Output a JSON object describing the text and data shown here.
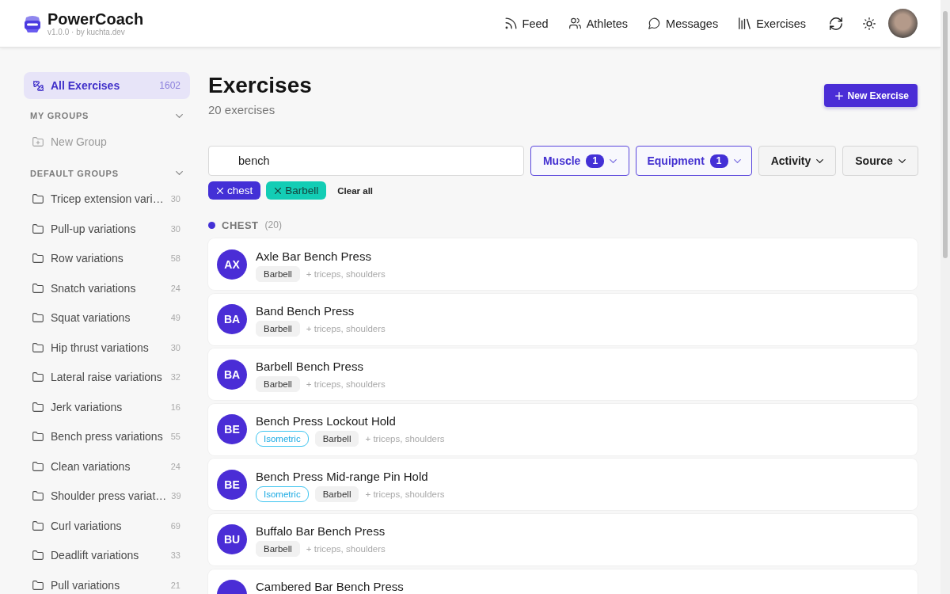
{
  "header": {
    "app_name": "PowerCoach",
    "version": "v1.0.0 · by kuchta.dev",
    "nav": [
      {
        "label": "Feed"
      },
      {
        "label": "Athletes"
      },
      {
        "label": "Messages"
      },
      {
        "label": "Exercises"
      }
    ]
  },
  "sidebar": {
    "all_item": {
      "label": "All Exercises",
      "count": "1602",
      "selected": true
    },
    "sections": [
      {
        "title": "MY GROUPS",
        "expanded": true,
        "items": [
          {
            "kind": "add",
            "label": "New Group"
          }
        ]
      },
      {
        "title": "DEFAULT GROUPS",
        "expanded": true,
        "items": [
          {
            "kind": "group",
            "label": "Tricep extension vari…",
            "count": "30"
          },
          {
            "kind": "group",
            "label": "Pull-up variations",
            "count": "30"
          },
          {
            "kind": "group",
            "label": "Row variations",
            "count": "58"
          },
          {
            "kind": "group",
            "label": "Snatch variations",
            "count": "24"
          },
          {
            "kind": "group",
            "label": "Squat variations",
            "count": "49"
          },
          {
            "kind": "group",
            "label": "Hip thrust variations",
            "count": "30"
          },
          {
            "kind": "group",
            "label": "Lateral raise variations",
            "count": "32"
          },
          {
            "kind": "group",
            "label": "Jerk variations",
            "count": "16"
          },
          {
            "kind": "group",
            "label": "Bench press variations",
            "count": "55"
          },
          {
            "kind": "group",
            "label": "Clean variations",
            "count": "24"
          },
          {
            "kind": "group",
            "label": "Shoulder press variat…",
            "count": "39"
          },
          {
            "kind": "group",
            "label": "Curl variations",
            "count": "69"
          },
          {
            "kind": "group",
            "label": "Deadlift variations",
            "count": "33"
          },
          {
            "kind": "group",
            "label": "Pull variations",
            "count": "21"
          }
        ]
      }
    ]
  },
  "main": {
    "title": "Exercises",
    "subtitle": "20 exercises",
    "new_button": "New Exercise",
    "search": {
      "value": "bench"
    },
    "filters": [
      {
        "label": "Muscle",
        "count": "1",
        "active": true
      },
      {
        "label": "Equipment",
        "count": "1",
        "active": true
      },
      {
        "label": "Activity",
        "active": false
      },
      {
        "label": "Source",
        "active": false
      }
    ],
    "chips": [
      {
        "label": "chest",
        "color": "#4330d6"
      },
      {
        "label": "Barbell",
        "color": "#13cdb5"
      }
    ],
    "clear_all": "Clear all",
    "group": {
      "label": "CHEST",
      "count": "(20)",
      "color": "#4330d6"
    },
    "exercises": [
      {
        "initials": "AX",
        "name": "Axle Bar Bench Press",
        "tags": [
          {
            "kind": "equipment",
            "label": "Barbell"
          }
        ],
        "muscles": "+ triceps, shoulders"
      },
      {
        "initials": "BA",
        "name": "Band Bench Press",
        "tags": [
          {
            "kind": "equipment",
            "label": "Barbell"
          }
        ],
        "muscles": "+ triceps, shoulders"
      },
      {
        "initials": "BA",
        "name": "Barbell Bench Press",
        "tags": [
          {
            "kind": "equipment",
            "label": "Barbell"
          }
        ],
        "muscles": "+ triceps, shoulders"
      },
      {
        "initials": "BE",
        "name": "Bench Press Lockout Hold",
        "tags": [
          {
            "kind": "activity",
            "label": "Isometric"
          },
          {
            "kind": "equipment",
            "label": "Barbell"
          }
        ],
        "muscles": "+ triceps, shoulders"
      },
      {
        "initials": "BE",
        "name": "Bench Press Mid-range Pin Hold",
        "tags": [
          {
            "kind": "activity",
            "label": "Isometric"
          },
          {
            "kind": "equipment",
            "label": "Barbell"
          }
        ],
        "muscles": "+ triceps, shoulders"
      },
      {
        "initials": "BU",
        "name": "Buffalo Bar Bench Press",
        "tags": [
          {
            "kind": "equipment",
            "label": "Barbell"
          }
        ],
        "muscles": "+ triceps, shoulders"
      },
      {
        "name": "Cambered Bar Bench Press"
      }
    ]
  }
}
